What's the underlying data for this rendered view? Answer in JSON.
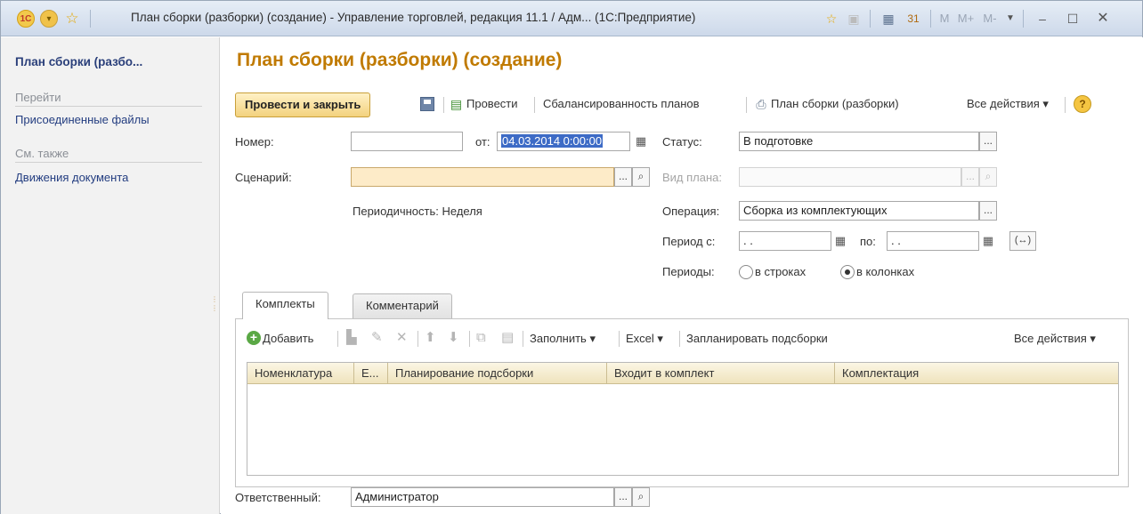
{
  "titlebar": {
    "logo": "1С",
    "title": "План сборки (разборки) (создание) - Управление торговлей, редакция 11.1 / Адм...  (1С:Предприятие)",
    "icons": [
      "star-icon",
      "history-icon",
      "calculator-icon",
      "calendar-icon"
    ],
    "mem": [
      "M",
      "M+",
      "M-"
    ]
  },
  "sidebar": {
    "doc_title": "План сборки (разбо...",
    "goto_header": "Перейти",
    "goto_items": [
      "Присоединенные файлы"
    ],
    "see_also_header": "См. также",
    "see_also_items": [
      "Движения документа"
    ]
  },
  "form": {
    "title": "План сборки (разборки) (создание)",
    "toolbar": {
      "post_close": "Провести и закрыть",
      "post": "Провести",
      "balance": "Сбалансированность планов",
      "print": "План сборки (разборки)",
      "all_actions": "Все действия"
    },
    "number_label": "Номер:",
    "number_value": "",
    "from_label": "от:",
    "date_value": "04.03.2014  0:00:00",
    "status_label": "Статус:",
    "status_value": "В подготовке",
    "scenario_label": "Сценарий:",
    "scenario_value": "",
    "plan_type_label": "Вид плана:",
    "plan_type_value": "",
    "periodicity_text": "Периодичность: Неделя",
    "operation_label": "Операция:",
    "operation_value": "Сборка из комплектующих",
    "period_from_label": "Период с:",
    "period_from_value": " .  .",
    "period_to_label": "по:",
    "period_to_value": " .  .",
    "periods_label": "Периоды:",
    "radio_rows": "в строках",
    "radio_cols": "в колонках",
    "radio_selected": "cols",
    "tabs": [
      "Комплекты",
      "Комментарий"
    ],
    "grid_toolbar": {
      "add": "Добавить",
      "fill": "Заполнить",
      "excel": "Excel",
      "schedule": "Запланировать подсборки",
      "all_actions": "Все действия"
    },
    "columns": [
      "Номенклатура",
      "Е...",
      "Планирование подсборки",
      "Входит в комплект",
      "Комплектация"
    ],
    "rows": [],
    "responsible_label": "Ответственный:",
    "responsible_value": "Администратор"
  }
}
